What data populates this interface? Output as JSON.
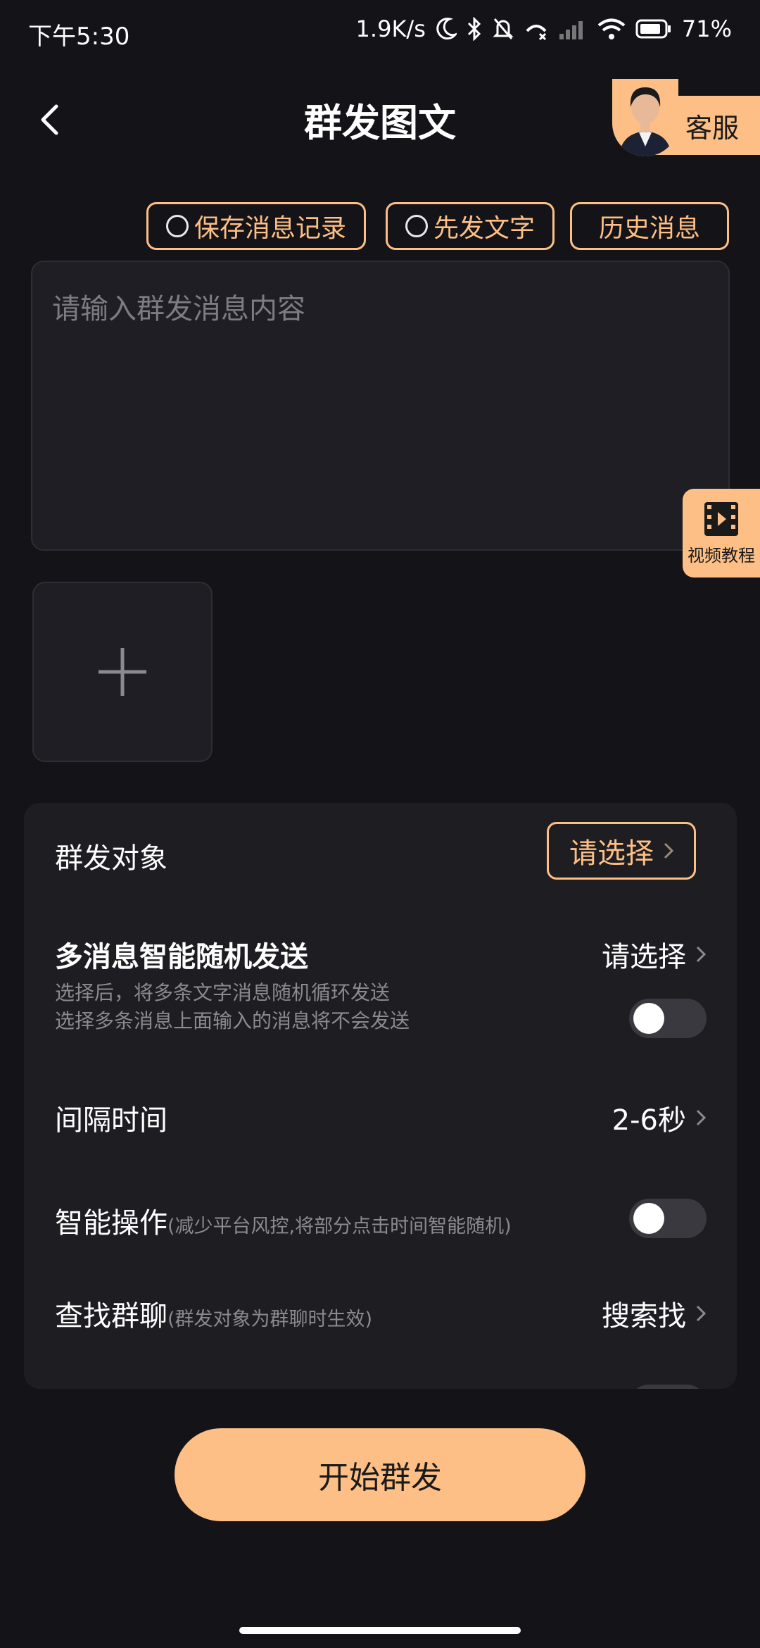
{
  "status_bar": {
    "time": "下午5:30",
    "net_speed": "1.9K/s",
    "battery": "71%"
  },
  "header": {
    "title": "群发图文",
    "service_label": "客服"
  },
  "options": {
    "save_record": "保存消息记录",
    "text_first": "先发文字",
    "history": "历史消息"
  },
  "message_input": {
    "placeholder": "请输入群发消息内容",
    "value": ""
  },
  "video_tutorial": {
    "label": "视频教程"
  },
  "settings": {
    "target": {
      "label": "群发对象",
      "action": "请选择"
    },
    "random_send": {
      "label": "多消息智能随机发送",
      "value": "请选择",
      "desc_line1": "选择后，将多条文字消息随机循环发送",
      "desc_line2": "选择多条消息上面输入的消息将不会发送",
      "enabled": false
    },
    "interval": {
      "label": "间隔时间",
      "value": "2-6秒"
    },
    "smart_op": {
      "label": "智能操作",
      "hint": "(减少平台风控,将部分点击时间智能随机)",
      "enabled": false
    },
    "find_group": {
      "label": "查找群聊",
      "hint": "(群发对象为群聊时生效)",
      "value": "搜索找"
    }
  },
  "start_button": {
    "label": "开始群发"
  },
  "colors": {
    "accent": "#fdbf85",
    "background": "#131318",
    "card": "#1e1d22"
  }
}
